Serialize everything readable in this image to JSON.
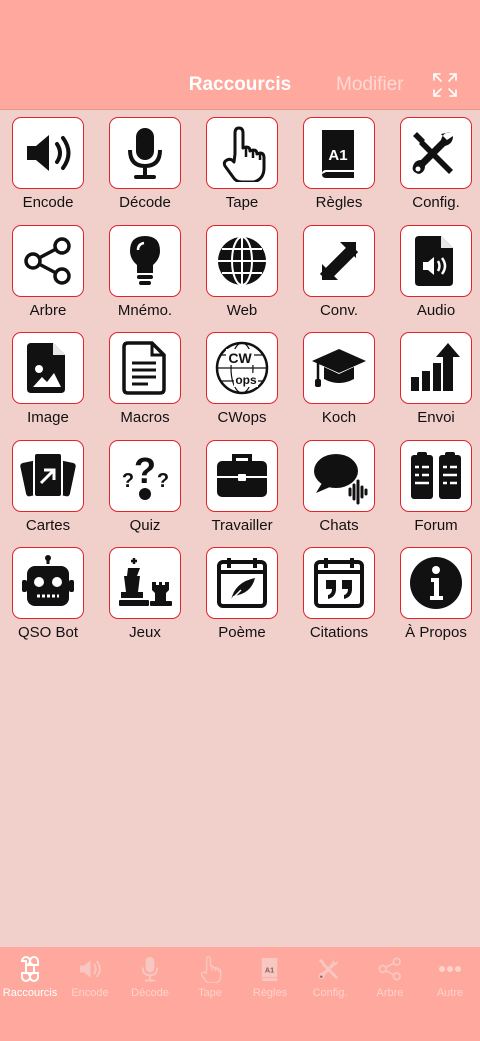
{
  "header": {
    "title": "Raccourcis",
    "modify_label": "Modifier",
    "expand_icon": "expand-icon"
  },
  "colors": {
    "header_bg": "#ffa89d",
    "page_bg": "#f1d0cc",
    "tile_border": "#e0242a",
    "icon": "#111111"
  },
  "shortcuts": [
    {
      "label": "Encode",
      "icon": "speaker-icon"
    },
    {
      "label": "Décode",
      "icon": "microphone-icon"
    },
    {
      "label": "Tape",
      "icon": "pointer-hand-icon"
    },
    {
      "label": "Règles",
      "icon": "rule-book-icon"
    },
    {
      "label": "Config.",
      "icon": "tools-icon"
    },
    {
      "label": "Arbre",
      "icon": "share-tree-icon"
    },
    {
      "label": "Mnémo.",
      "icon": "lightbulb-icon"
    },
    {
      "label": "Web",
      "icon": "globe-icon"
    },
    {
      "label": "Conv.",
      "icon": "convert-arrows-icon"
    },
    {
      "label": "Audio",
      "icon": "audio-file-icon"
    },
    {
      "label": "Image",
      "icon": "image-file-icon"
    },
    {
      "label": "Macros",
      "icon": "document-icon"
    },
    {
      "label": "CWops",
      "icon": "cwops-globe-icon"
    },
    {
      "label": "Koch",
      "icon": "graduation-cap-icon"
    },
    {
      "label": "Envoi",
      "icon": "signal-bars-icon"
    },
    {
      "label": "Cartes",
      "icon": "cards-icon"
    },
    {
      "label": "Quiz",
      "icon": "question-marks-icon"
    },
    {
      "label": "Travailler",
      "icon": "briefcase-icon"
    },
    {
      "label": "Chats",
      "icon": "chat-bubble-icon"
    },
    {
      "label": "Forum",
      "icon": "clipboards-icon"
    },
    {
      "label": "QSO Bot",
      "icon": "robot-icon"
    },
    {
      "label": "Jeux",
      "icon": "chess-icon"
    },
    {
      "label": "Poème",
      "icon": "calendar-quill-icon"
    },
    {
      "label": "Citations",
      "icon": "calendar-quote-icon"
    },
    {
      "label": "À Propos",
      "icon": "info-icon"
    }
  ],
  "tabs": [
    {
      "label": "Raccourcis",
      "icon": "command-icon",
      "active": true
    },
    {
      "label": "Encode",
      "icon": "speaker-icon",
      "active": false
    },
    {
      "label": "Décode",
      "icon": "microphone-icon",
      "active": false
    },
    {
      "label": "Tape",
      "icon": "pointer-hand-icon",
      "active": false
    },
    {
      "label": "Règles",
      "icon": "rule-book-icon",
      "active": false
    },
    {
      "label": "Config.",
      "icon": "tools-icon",
      "active": false
    },
    {
      "label": "Arbre",
      "icon": "share-tree-icon",
      "active": false
    },
    {
      "label": "Autre",
      "icon": "more-dots-icon",
      "active": false
    }
  ]
}
